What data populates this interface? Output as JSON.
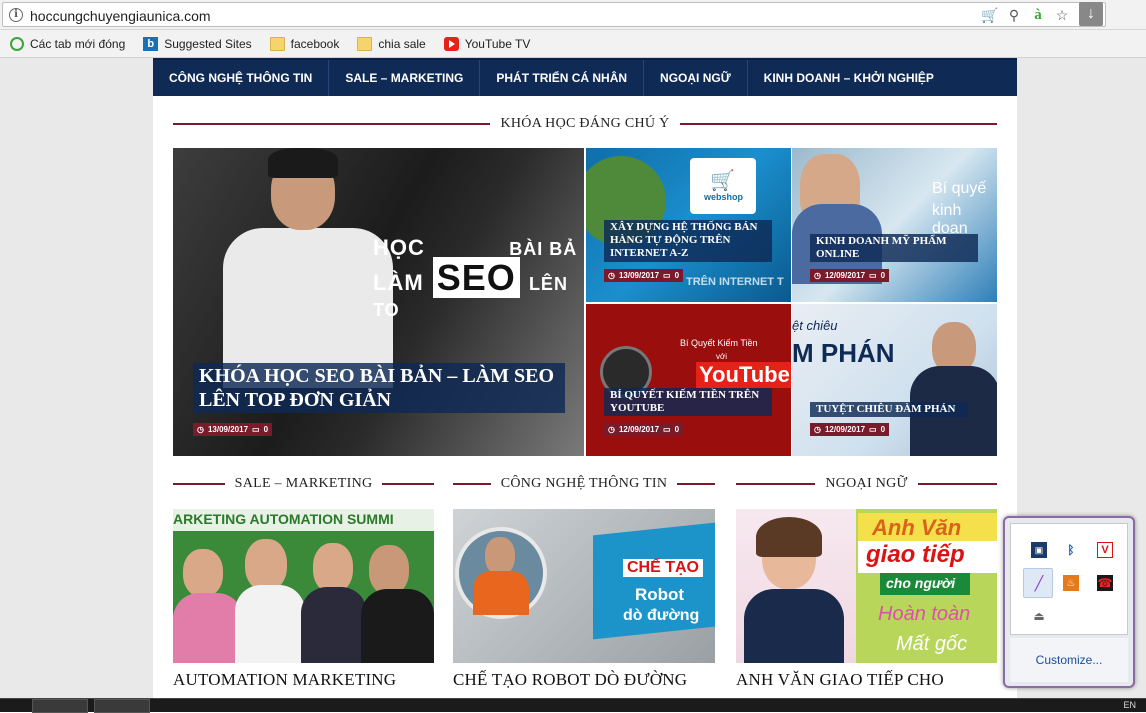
{
  "browser": {
    "url": "hoccungchuyengiaunica.com",
    "bookmarks": [
      {
        "label": "Các tab mới đóng"
      },
      {
        "label": "Suggested Sites"
      },
      {
        "label": "facebook"
      },
      {
        "label": "chia sale"
      },
      {
        "label": "YouTube TV"
      }
    ]
  },
  "nav": {
    "items": [
      "CÔNG NGHỆ THÔNG TIN",
      "SALE – MARKETING",
      "PHÁT TRIỂN CÁ NHÂN",
      "NGOẠI NGỮ",
      "KINH DOANH – KHỞI NGHIỆP"
    ]
  },
  "featured": {
    "section_title": "KHÓA HỌC ĐÁNG CHÚ Ý",
    "hero": {
      "image_text_1": "HỌC",
      "image_text_2": "LÀM",
      "image_text_seo": "SEO",
      "image_text_3": "BÀI BẢ",
      "image_text_4": "LÊN TO",
      "title": "KHÓA HỌC SEO BÀI BẢN – LÀM SEO LÊN TOP ĐƠN GIẢN",
      "date": "13/09/2017",
      "comments": "0"
    },
    "tiles": [
      {
        "title": "XÂY DỰNG HỆ THỐNG BÁN HÀNG TỰ ĐỘNG TRÊN INTERNET A-Z",
        "date": "13/09/2017",
        "comments": "0",
        "image_text": "webshop",
        "image_text_2": "TRÊN INTERNET T"
      },
      {
        "title": "KINH DOANH MỸ PHẨM ONLINE",
        "date": "12/09/2017",
        "comments": "0",
        "image_text": "Bí quyế",
        "image_text_2": "kinh doan"
      },
      {
        "title": "BÍ QUYẾT KIẾM TIỀN TRÊN YOUTUBE",
        "date": "12/09/2017",
        "comments": "0",
        "image_text": "Bí Quyết Kiếm Tiền",
        "image_text_2": "với",
        "image_text_3": "YouTube"
      },
      {
        "title": "TUYỆT CHIÊU ĐÀM PHÁN",
        "date": "12/09/2017",
        "comments": "0",
        "image_text": "ệt chiêu",
        "image_text_2": "M PHÁN"
      }
    ]
  },
  "categories": [
    {
      "section_title": "SALE – MARKETING",
      "image_text": "ARKETING AUTOMATION SUMMI",
      "post_title": "AUTOMATION MARKETING"
    },
    {
      "section_title": "CÔNG NGHỆ THÔNG TIN",
      "image_text_1": "CHẾ TẠO",
      "image_text_2": "Robot",
      "image_text_3": "dò đường",
      "post_title": "CHẾ TẠO ROBOT DÒ ĐƯỜNG"
    },
    {
      "section_title": "NGOẠI NGỮ",
      "image_text_1": "Anh Văn",
      "image_text_2": "giao tiếp",
      "image_text_3": "cho người",
      "image_text_4": "Hoàn toàn",
      "image_text_5": "Mất gốc",
      "post_title": "ANH VĂN GIAO TIẾP CHO"
    }
  ],
  "tray": {
    "customize_label": "Customize..."
  },
  "taskbar": {
    "lang": "EN"
  },
  "colors": {
    "nav_bg": "#0e2a55",
    "accent": "#7a1b2b"
  }
}
